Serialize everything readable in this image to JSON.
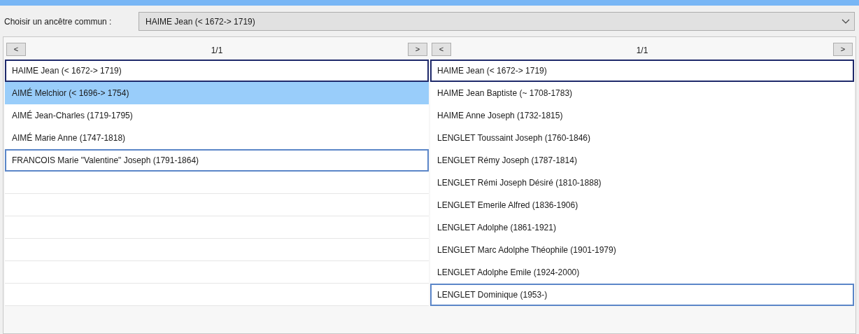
{
  "selector": {
    "label": "Choisir un ancêtre commun :",
    "value": "HAIME Jean (< 1672-> 1719)"
  },
  "columns": [
    {
      "prev": "<",
      "next": ">",
      "page": "1/1",
      "rows": [
        {
          "text": "HAIME Jean (< 1672-> 1719)",
          "kind": "root",
          "selected": false
        },
        {
          "text": "AIMÉ Melchior (< 1696-> 1754)",
          "kind": "normal",
          "selected": true
        },
        {
          "text": "AIMÉ Jean-Charles (1719-1795)",
          "kind": "normal",
          "selected": false
        },
        {
          "text": "AIMÉ Marie Anne (1747-1818)",
          "kind": "normal",
          "selected": false
        },
        {
          "text": "FRANCOIS Marie \"Valentine\" Joseph (1791-1864)",
          "kind": "end",
          "selected": false
        }
      ]
    },
    {
      "prev": "<",
      "next": ">",
      "page": "1/1",
      "rows": [
        {
          "text": "HAIME Jean (< 1672-> 1719)",
          "kind": "root",
          "selected": false
        },
        {
          "text": "HAIME Jean Baptiste (~ 1708-1783)",
          "kind": "normal",
          "selected": false
        },
        {
          "text": "HAIME Anne Joseph (1732-1815)",
          "kind": "normal",
          "selected": false
        },
        {
          "text": "LENGLET Toussaint Joseph (1760-1846)",
          "kind": "normal",
          "selected": false
        },
        {
          "text": "LENGLET Rémy Joseph (1787-1814)",
          "kind": "normal",
          "selected": false
        },
        {
          "text": "LENGLET Rémi Joseph Désiré (1810-1888)",
          "kind": "normal",
          "selected": false
        },
        {
          "text": "LENGLET Emerile Alfred (1836-1906)",
          "kind": "normal",
          "selected": false
        },
        {
          "text": "LENGLET Adolphe (1861-1921)",
          "kind": "normal",
          "selected": false
        },
        {
          "text": "LENGLET Marc Adolphe Théophile (1901-1979)",
          "kind": "normal",
          "selected": false
        },
        {
          "text": "LENGLET Adolphe Emile (1924-2000)",
          "kind": "normal",
          "selected": false
        },
        {
          "text": "LENGLET Dominique (1953-)",
          "kind": "end",
          "selected": false
        }
      ]
    }
  ]
}
